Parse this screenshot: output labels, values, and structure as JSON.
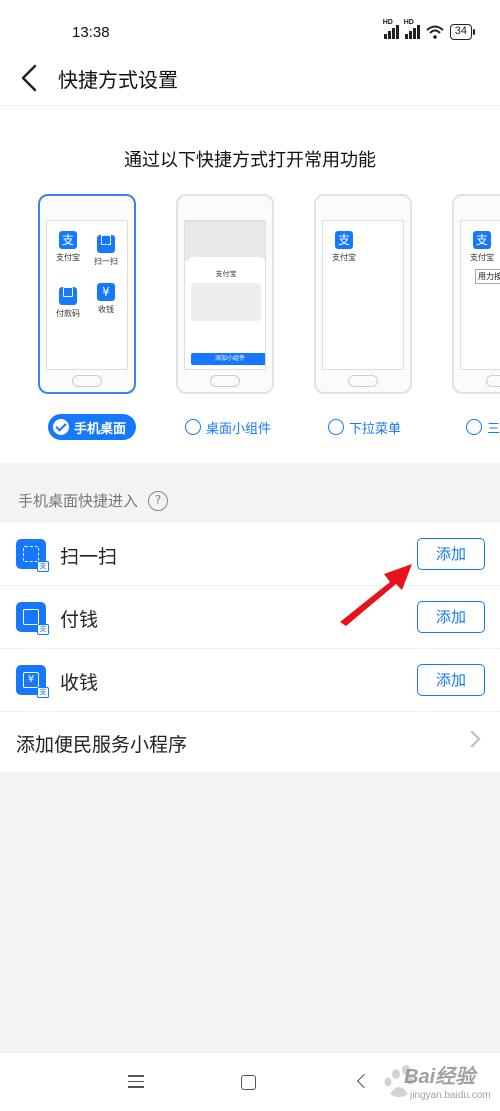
{
  "status_bar": {
    "time": "13:38",
    "signal_1_label": "HD",
    "signal_2_label": "HD",
    "battery": "34"
  },
  "header": {
    "title": "快捷方式设置",
    "back_icon": "back-arrow"
  },
  "shortcut_panel": {
    "heading": "通过以下快捷方式打开常用功能",
    "phone_desktop_apps": [
      "支付宝",
      "扫一扫",
      "付款码",
      "收钱"
    ],
    "widget_preview": {
      "app_name": "支付宝",
      "button": "添加小组件"
    },
    "dropdown_preview": {
      "app_name": "支付宝"
    },
    "fourth_preview": {
      "app_name": "支付宝",
      "tag": "用力按"
    },
    "options": [
      {
        "label": "手机桌面",
        "selected": true
      },
      {
        "label": "桌面小组件",
        "selected": false
      },
      {
        "label": "下拉菜单",
        "selected": false
      },
      {
        "label": "三",
        "selected": false
      }
    ]
  },
  "section": {
    "title": "手机桌面快捷进入",
    "help_icon_text": "?"
  },
  "items": [
    {
      "label": "扫一扫",
      "button": "添加",
      "icon": "scan-icon"
    },
    {
      "label": "付钱",
      "button": "添加",
      "icon": "pay-code-icon"
    },
    {
      "label": "收钱",
      "button": "添加",
      "icon": "receive-money-icon"
    }
  ],
  "service_row": {
    "label": "添加便民服务小程序"
  },
  "watermark": {
    "text": "Bai经验",
    "url": "jingyan.baidu.com"
  },
  "colors": {
    "accent": "#1677ff",
    "arrow": "#e8121a",
    "background": "#f3f3f5"
  }
}
